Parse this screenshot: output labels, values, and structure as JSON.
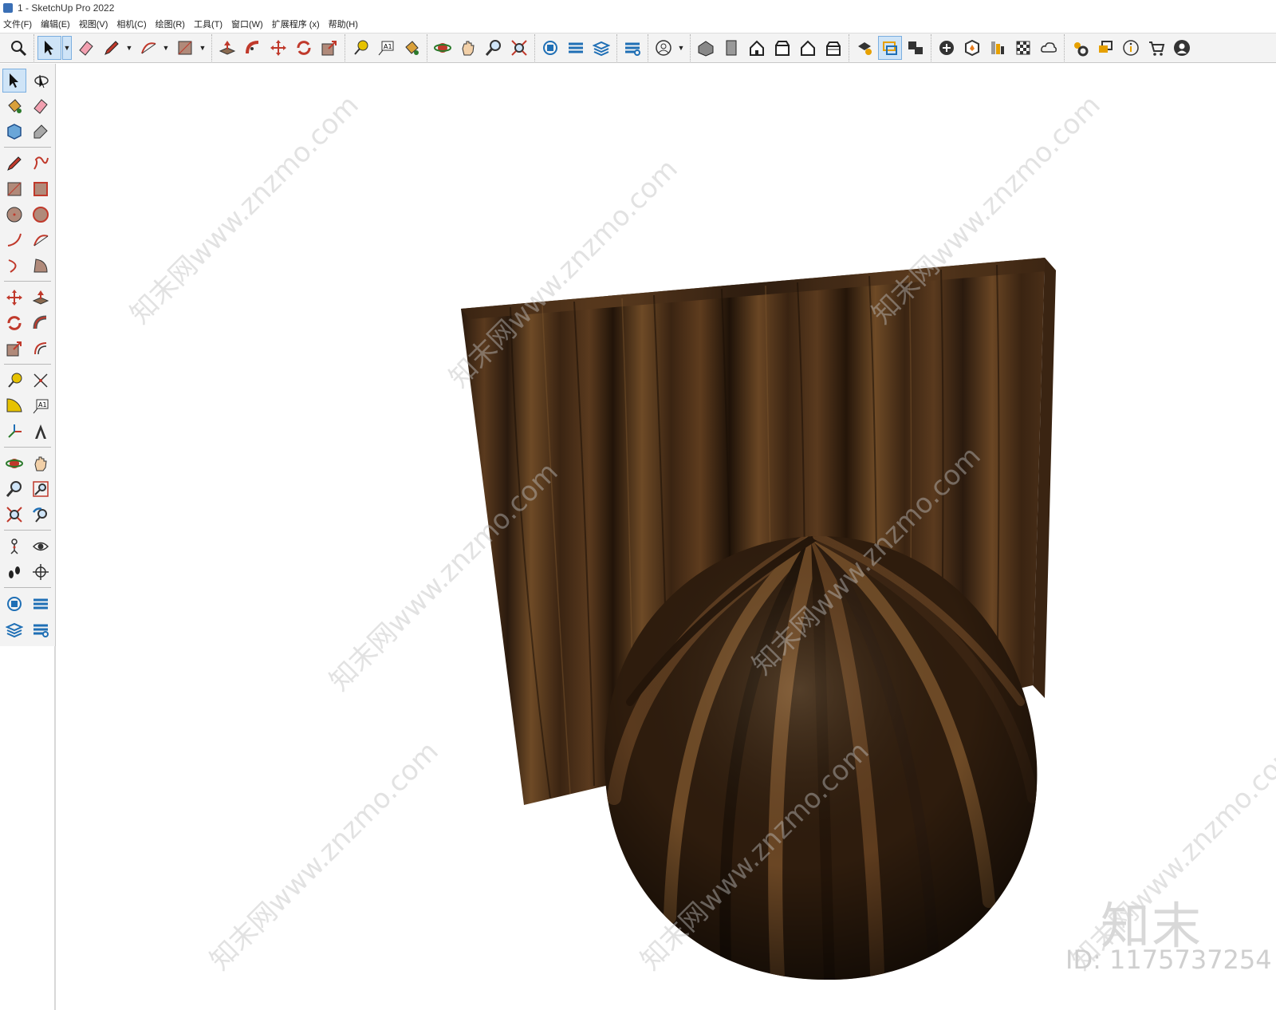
{
  "window": {
    "title": "1 - SketchUp Pro 2022"
  },
  "menu": [
    "文件(F)",
    "编辑(E)",
    "视图(V)",
    "相机(C)",
    "绘图(R)",
    "工具(T)",
    "窗口(W)",
    "扩展程序 (x)",
    "帮助(H)"
  ],
  "toolbar_icons": {
    "search": "search-icon",
    "select": "select-arrow-icon",
    "eraser": "eraser-icon",
    "pencil": "pencil-icon",
    "arc": "arc-icon",
    "rectangle": "rectangle-icon",
    "push_pull": "push-pull-icon",
    "follow_me": "follow-me-icon",
    "move": "move-icon",
    "rotate": "rotate-icon",
    "scale": "scale-icon",
    "tape": "tape-measure-icon",
    "text": "text-icon",
    "paint": "paint-bucket-icon",
    "orbit": "orbit-icon",
    "pan": "pan-icon",
    "zoom": "zoom-icon",
    "zoom_extents": "zoom-extents-icon",
    "warehouse": "warehouse-icon",
    "ext_warehouse": "extension-warehouse-icon",
    "layout": "layout-icon",
    "ext_manager": "extension-manager-icon",
    "user": "user-icon",
    "iso": "iso-view-icon",
    "top": "top-view-icon",
    "front": "front-view-icon",
    "right": "right-view-icon",
    "back": "back-view-icon",
    "left": "left-view-icon",
    "styles": "styles-icon",
    "xray": "xray-icon",
    "scenes": "scenes-icon",
    "add": "add-icon",
    "solid": "solid-icon",
    "layers": "layers-icon",
    "checker": "checker-icon",
    "cloud": "cloud-icon",
    "gears": "settings-icon",
    "message": "message-icon",
    "info": "info-icon",
    "cart": "cart-icon",
    "account": "account-icon"
  },
  "watermark": {
    "site": "知末网www.znzmo.com",
    "brand": "知末",
    "id": "ID: 1175737254"
  },
  "colors": {
    "accent": "#cfe4f7",
    "wood_dark": "#2a1a0e",
    "wood_mid": "#4a2f18",
    "wood_light": "#6e4a26"
  }
}
